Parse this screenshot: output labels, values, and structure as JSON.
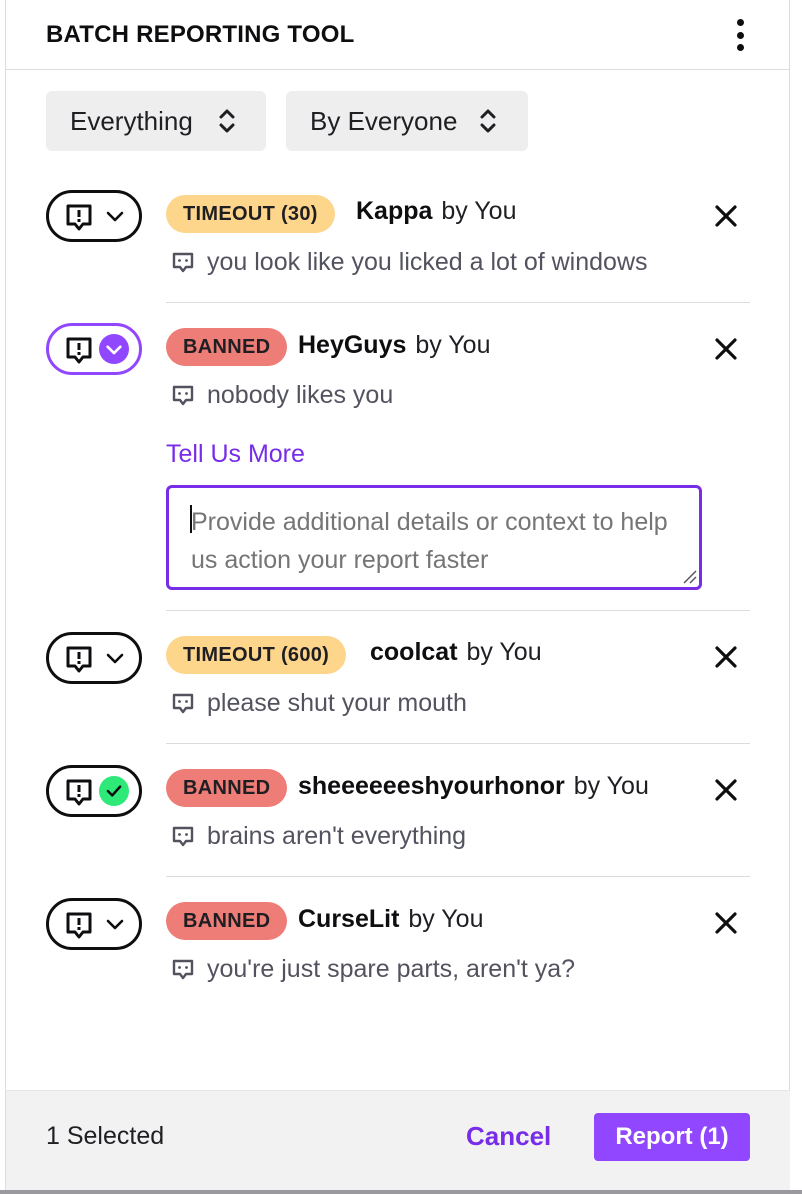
{
  "header": {
    "title": "BATCH REPORTING TOOL",
    "menu_icon": "more-vertical-icon"
  },
  "filters": {
    "content": {
      "value": "Everything",
      "icon": "sort-updown-icon"
    },
    "author": {
      "value": "By Everyone",
      "icon": "sort-updown-icon"
    }
  },
  "reports": [
    {
      "badge": "TIMEOUT (30)",
      "badge_type": "timeout",
      "user": "Kappa",
      "by": "by You",
      "message": "you look like you licked a lot of windows",
      "toggle_state": "default"
    },
    {
      "badge": "BANNED",
      "badge_type": "banned",
      "user": "HeyGuys",
      "by": "by You",
      "message": "nobody likes you",
      "toggle_state": "selected-open",
      "tell_more": "Tell Us More",
      "details_placeholder": "Provide additional details or context to help us action your report faster"
    },
    {
      "badge": "TIMEOUT (600)",
      "badge_type": "timeout",
      "user": "coolcat",
      "by": "by You",
      "message": "please shut your mouth",
      "toggle_state": "default"
    },
    {
      "badge": "BANNED",
      "badge_type": "banned",
      "user": "sheeeeeeshyourhonor",
      "by": "by You",
      "message": "brains aren't everything",
      "toggle_state": "reported"
    },
    {
      "badge": "BANNED",
      "badge_type": "banned",
      "user": "CurseLit",
      "by": "by You",
      "message": "you're just spare parts, aren't ya?",
      "toggle_state": "default"
    }
  ],
  "footer": {
    "selected": "1 Selected",
    "cancel": "Cancel",
    "report": "Report (1)"
  },
  "colors": {
    "accent": "#9147ff",
    "link": "#772ce8",
    "timeout": "#fdd58b",
    "banned": "#ee7d77",
    "reported": "#2ee878"
  }
}
